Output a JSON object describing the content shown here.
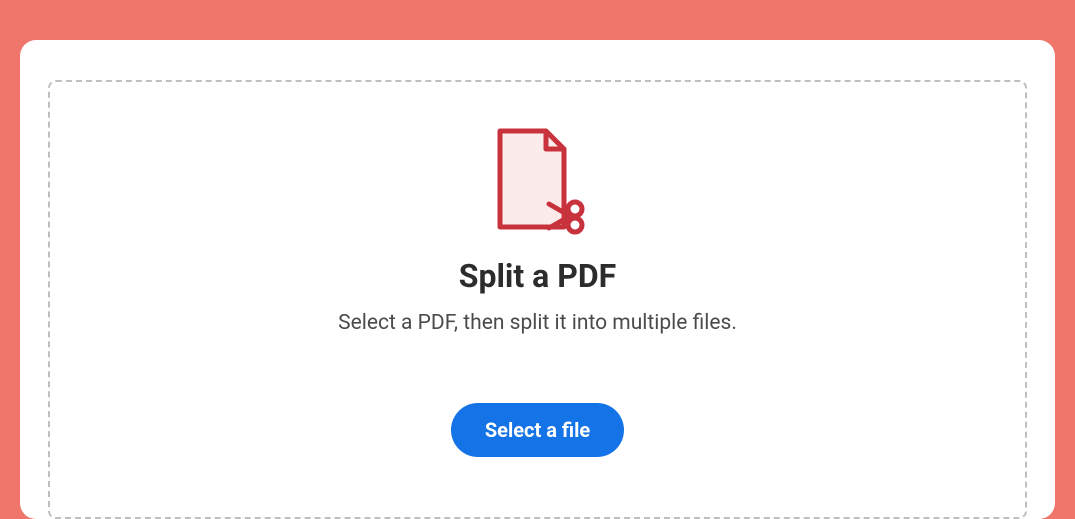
{
  "main": {
    "title": "Split a PDF",
    "subtitle": "Select a PDF, then split it into multiple files.",
    "select_button_label": "Select a file"
  },
  "colors": {
    "background": "#f0756a",
    "card": "#ffffff",
    "accent_red": "#c8323c",
    "accent_fill": "#fbeceb",
    "button": "#1473e6"
  }
}
